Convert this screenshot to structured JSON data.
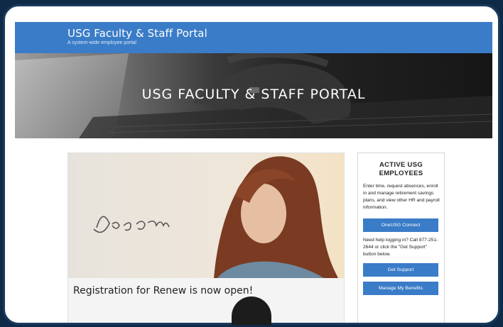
{
  "header": {
    "title": "USG Faculty & Staff Portal",
    "subtitle": "A system-wide employee portal"
  },
  "hero": {
    "headline": "USG FACULTY & STAFF PORTAL"
  },
  "feature": {
    "brand": "Renew",
    "caption": "Registration for Renew is now open!"
  },
  "sidebar": {
    "heading_line1": "ACTIVE USG",
    "heading_line2": "EMPLOYEES",
    "intro_text": "Enter time, request absences, enroll in and manage retirement savings plans, and view other HR and payroll information.",
    "connect_label": "OneUSG Connect",
    "help_text": "Need help logging in? Call 877-251-2644 or click the \"Get Support\" button below.",
    "support_label": "Get Support",
    "benefits_label": "Manage My Benefits"
  },
  "colors": {
    "brand_blue": "#3a7cc7",
    "frame": "#0f2a47"
  }
}
